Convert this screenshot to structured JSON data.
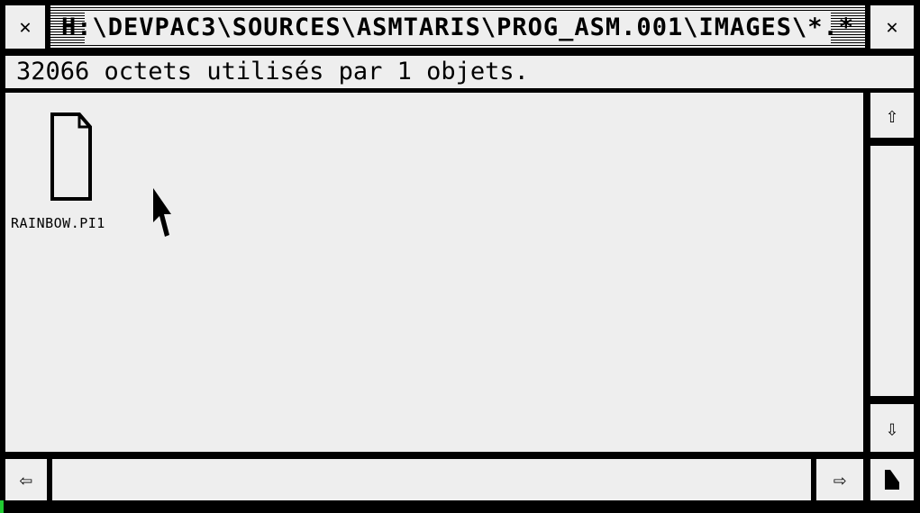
{
  "window": {
    "close_glyph": "✕",
    "full_glyph": "✕",
    "title": "H:\\DEVPAC3\\SOURCES\\ASMTARIS\\PROG_ASM.001\\IMAGES\\*.*",
    "info": "32066 octets utilisés par 1 objets."
  },
  "files": [
    {
      "name": "RAINBOW.PI1",
      "icon": "document-icon"
    }
  ],
  "scrollbars": {
    "up_glyph": "⇧",
    "down_glyph": "⇩",
    "left_glyph": "⇦",
    "right_glyph": "⇨"
  },
  "colors": {
    "frame": "#000000",
    "background": "#eeeeee",
    "accent_mark": "#22cc33"
  }
}
